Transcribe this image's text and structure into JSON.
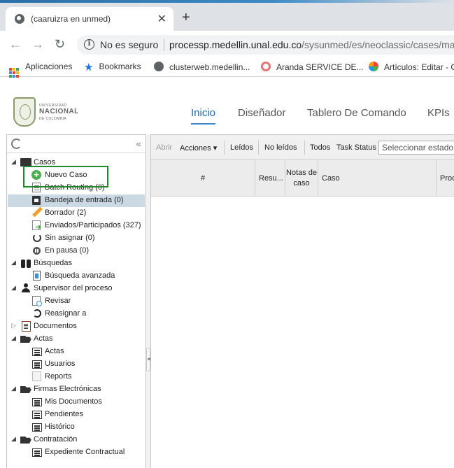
{
  "browser": {
    "tab_title": "(caaruizra en unmed)",
    "tab_close": "✕",
    "new_tab": "+",
    "nav_back": "←",
    "nav_forward": "→",
    "nav_reload": "↻",
    "security_text": "No es seguro",
    "url_host": "processp.medellin.unal.edu.co",
    "url_path": "/sysunmed/es/neoclassic/cases/mai",
    "bookmarks": [
      {
        "label": "Aplicaciones",
        "icon": "apps-grid-icon"
      },
      {
        "label": "Bookmarks",
        "icon": "star-icon"
      },
      {
        "label": "clusterweb.medellin...",
        "icon": "globe-icon"
      },
      {
        "label": "Aranda SERVICE DE...",
        "icon": "aranda-icon"
      },
      {
        "label": "Artículos: Editar - G",
        "icon": "joomla-icon"
      }
    ]
  },
  "header": {
    "logo": {
      "line1": "UNIVERSIDAD",
      "line2": "NACIONAL",
      "line3": "DE COLOMBIA"
    },
    "nav": [
      {
        "label": "Inicio",
        "active": true
      },
      {
        "label": "Diseñador",
        "active": false
      },
      {
        "label": "Tablero De Comando",
        "active": false
      },
      {
        "label": "KPIs",
        "active": false
      }
    ]
  },
  "tree": {
    "collapse_icon": "«",
    "items": [
      {
        "label": "Casos",
        "icon": "folder-open-icon",
        "level": 0,
        "expanded": true
      },
      {
        "label": "Nuevo Caso",
        "icon": "plus-circle-icon",
        "level": 1
      },
      {
        "label": "Batch Routing (0)",
        "icon": "batch-routing-icon",
        "level": 1
      },
      {
        "label": "Bandeja de entrada (0)",
        "icon": "inbox-icon",
        "level": 1,
        "selected": true
      },
      {
        "label": "Borrador (2)",
        "icon": "pencil-icon",
        "level": 1
      },
      {
        "label": "Enviados/Participados (327)",
        "icon": "sent-icon",
        "level": 1
      },
      {
        "label": "Sin asignar (0)",
        "icon": "unassigned-icon",
        "level": 1
      },
      {
        "label": "En pausa (0)",
        "icon": "pause-icon",
        "level": 1
      },
      {
        "label": "Búsquedas",
        "icon": "binoculars-icon",
        "level": 0,
        "expanded": true
      },
      {
        "label": "Búsqueda avanzada",
        "icon": "advanced-search-icon",
        "level": 1
      },
      {
        "label": "Supervisor del proceso",
        "icon": "user-icon",
        "level": 0,
        "expanded": true
      },
      {
        "label": "Revisar",
        "icon": "review-icon",
        "level": 1
      },
      {
        "label": "Reasignar a",
        "icon": "reassign-icon",
        "level": 1
      },
      {
        "label": "Documentos",
        "icon": "documents-icon",
        "level": 0,
        "expanded": false
      },
      {
        "label": "Actas",
        "icon": "folder-open-icon",
        "level": 0,
        "expanded": true
      },
      {
        "label": "Actas",
        "icon": "list-icon",
        "level": 1
      },
      {
        "label": "Usuarios",
        "icon": "list-icon",
        "level": 1
      },
      {
        "label": "Reports",
        "icon": "reports-icon",
        "level": 1
      },
      {
        "label": "Firmas Electrónicas",
        "icon": "folder-open-icon",
        "level": 0,
        "expanded": true
      },
      {
        "label": "Mis Documentos",
        "icon": "list-icon",
        "level": 1
      },
      {
        "label": "Pendientes",
        "icon": "list-icon",
        "level": 1
      },
      {
        "label": "Histórico",
        "icon": "list-icon",
        "level": 1
      },
      {
        "label": "Contratación",
        "icon": "folder-open-icon",
        "level": 0,
        "expanded": true
      },
      {
        "label": "Expediente Contractual",
        "icon": "list-icon",
        "level": 1
      }
    ]
  },
  "toolbar": {
    "open": "Abrir",
    "actions": "Acciones ▾",
    "read": "Leídos",
    "unread": "No leídos",
    "all": "Todos",
    "task_status_label": "Task Status",
    "task_status_placeholder": "Seleccionar estado"
  },
  "grid": {
    "columns": [
      "#",
      "Resu...",
      "Notas de caso",
      "Caso",
      "Proc"
    ]
  },
  "colors": {
    "active_nav": "#1c6aa8",
    "highlight_box": "#1f8a2c",
    "selected_row": "#cbd9e4"
  }
}
